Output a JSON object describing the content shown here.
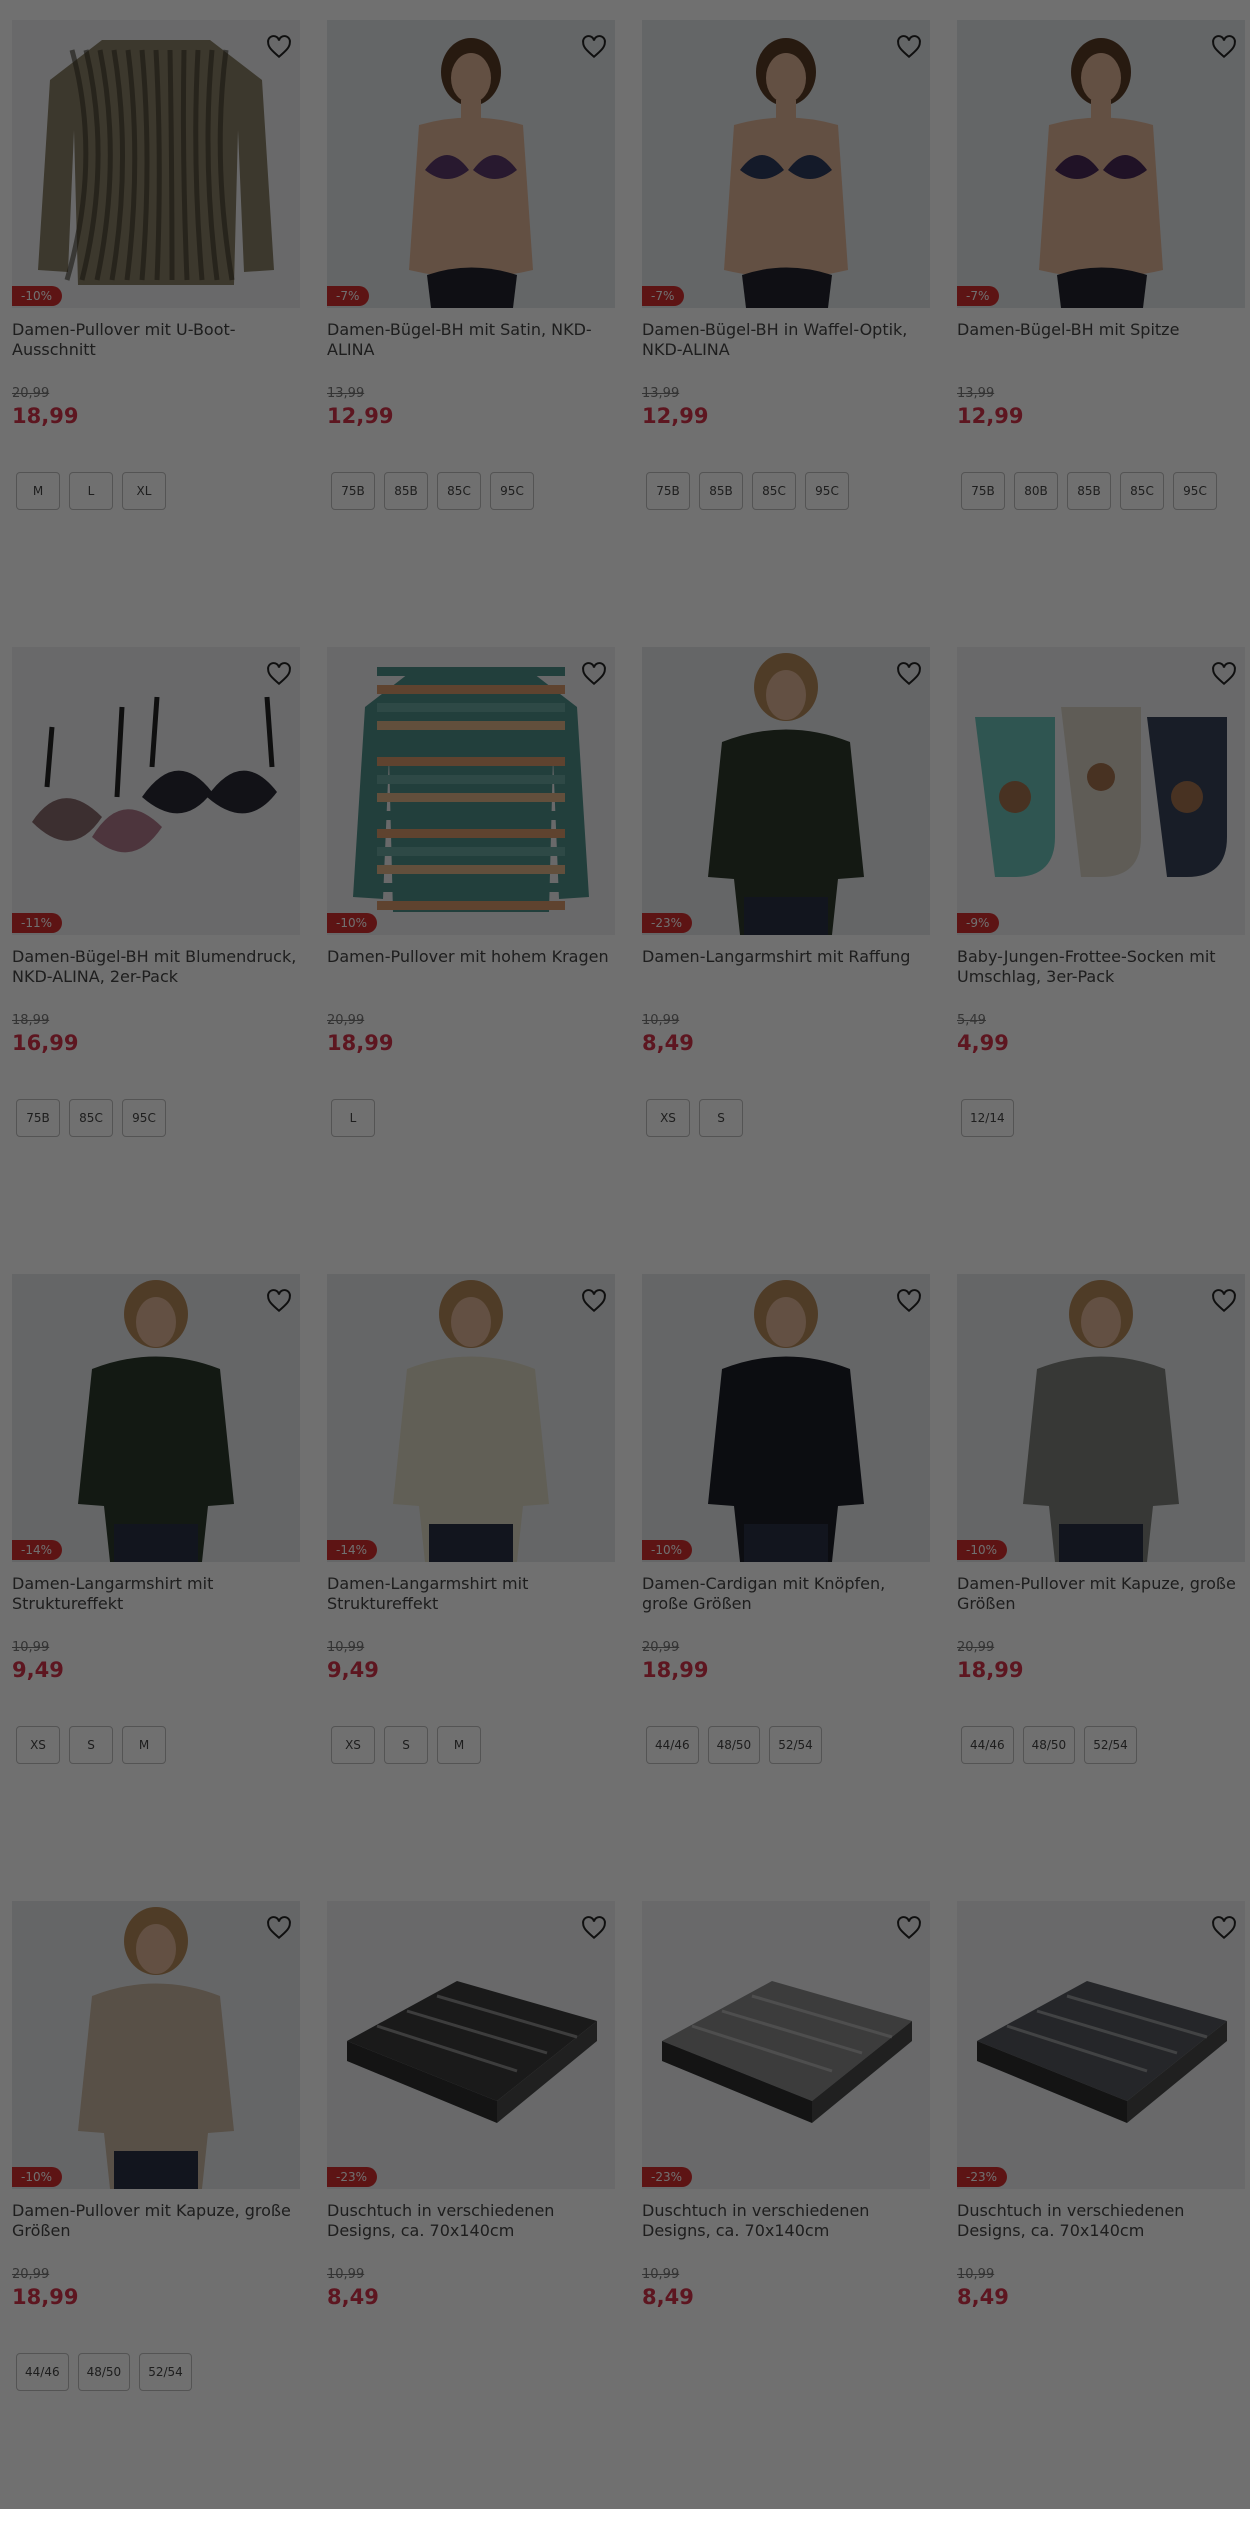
{
  "products": [
    {
      "title": "Damen-Pullover mit U-Boot-Ausschnitt",
      "badge": "-10%",
      "old_price": "20,99",
      "price": "18,99",
      "sizes": [
        "M",
        "L",
        "XL"
      ],
      "image": "sweater-pattern",
      "color": "#8a7f66"
    },
    {
      "title": "Damen-Bügel-BH mit Satin, NKD-ALINA",
      "badge": "-7%",
      "old_price": "13,99",
      "price": "12,99",
      "sizes": [
        "75B",
        "85B",
        "85C",
        "95C"
      ],
      "image": "bra-model",
      "color": "#5b3a6b"
    },
    {
      "title": "Damen-Bügel-BH in Waffel-Optik, NKD-ALINA",
      "badge": "-7%",
      "old_price": "13,99",
      "price": "12,99",
      "sizes": [
        "75B",
        "85B",
        "85C",
        "95C"
      ],
      "image": "bra-model",
      "color": "#2f3b5e"
    },
    {
      "title": "Damen-Bügel-BH mit Spitze",
      "badge": "-7%",
      "old_price": "13,99",
      "price": "12,99",
      "sizes": [
        "75B",
        "80B",
        "85B",
        "85C",
        "95C"
      ],
      "image": "bra-model",
      "color": "#4a2a58"
    },
    {
      "title": "Damen-Bügel-BH mit Blumendruck, NKD-ALINA, 2er-Pack",
      "badge": "-11%",
      "old_price": "18,99",
      "price": "16,99",
      "sizes": [
        "75B",
        "85C",
        "95C"
      ],
      "image": "bra-pack",
      "color": "#2a2a35"
    },
    {
      "title": "Damen-Pullover mit hohem Kragen",
      "badge": "-10%",
      "old_price": "20,99",
      "price": "18,99",
      "sizes": [
        "L"
      ],
      "image": "sweater-striped",
      "color": "#4f8f8a"
    },
    {
      "title": "Damen-Langarmshirt mit Raffung",
      "badge": "-23%",
      "old_price": "10,99",
      "price": "8,49",
      "sizes": [
        "XS",
        "S"
      ],
      "image": "shirt-model",
      "color": "#2f3a2c"
    },
    {
      "title": "Baby-Jungen-Frottee-Socken mit Umschlag, 3er-Pack",
      "badge": "-9%",
      "old_price": "5,49",
      "price": "4,99",
      "sizes": [
        "12/14"
      ],
      "image": "socks",
      "color": "#6cc1b8"
    },
    {
      "title": "Damen-Langarmshirt mit Struktureffekt",
      "badge": "-14%",
      "old_price": "10,99",
      "price": "9,49",
      "sizes": [
        "XS",
        "S",
        "M"
      ],
      "image": "shirt-model",
      "color": "#2d3a2d"
    },
    {
      "title": "Damen-Langarmshirt mit Struktureffekt",
      "badge": "-14%",
      "old_price": "10,99",
      "price": "9,49",
      "sizes": [
        "XS",
        "S",
        "M"
      ],
      "image": "shirt-model",
      "color": "#ddd8c4"
    },
    {
      "title": "Damen-Cardigan mit Knöpfen, große Größen",
      "badge": "-10%",
      "old_price": "20,99",
      "price": "18,99",
      "sizes": [
        "44/46",
        "48/50",
        "52/54"
      ],
      "image": "shirt-model",
      "color": "#1d1f28"
    },
    {
      "title": "Damen-Pullover mit Kapuze, große Größen",
      "badge": "-10%",
      "old_price": "20,99",
      "price": "18,99",
      "sizes": [
        "44/46",
        "48/50",
        "52/54"
      ],
      "image": "shirt-model",
      "color": "#7d807b"
    },
    {
      "title": "Damen-Pullover mit Kapuze, große Größen",
      "badge": "-10%",
      "old_price": "20,99",
      "price": "18,99",
      "sizes": [
        "44/46",
        "48/50",
        "52/54"
      ],
      "image": "shirt-model",
      "color": "#c9b7a2"
    },
    {
      "title": "Duschtuch in verschiedenen Designs, ca. 70x140cm",
      "badge": "-23%",
      "old_price": "10,99",
      "price": "8,49",
      "sizes": [],
      "image": "towel",
      "color": "#3c3c3c"
    },
    {
      "title": "Duschtuch in verschiedenen Designs, ca. 70x140cm",
      "badge": "-23%",
      "old_price": "10,99",
      "price": "8,49",
      "sizes": [],
      "image": "towel",
      "color": "#8a8a8a"
    },
    {
      "title": "Duschtuch in verschiedenen Designs, ca. 70x140cm",
      "badge": "-23%",
      "old_price": "10,99",
      "price": "8,49",
      "sizes": [],
      "image": "towel",
      "color": "#55585e"
    }
  ],
  "icons": {
    "wishlist": "heart-outline-icon"
  },
  "colors": {
    "badge": "#d42e2e",
    "price": "#d4344a",
    "overlay": "rgba(0,0,0,0.56)"
  }
}
